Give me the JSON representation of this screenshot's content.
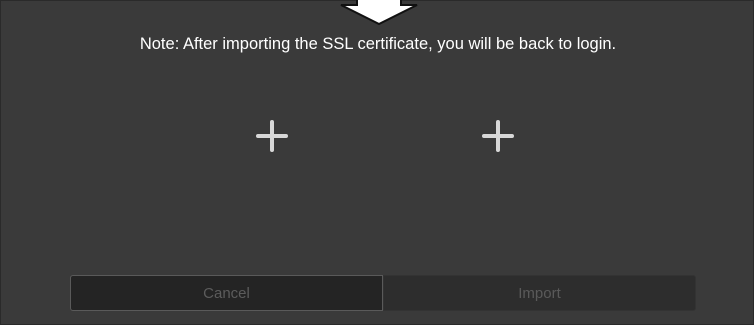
{
  "dialog": {
    "note": "Note: After importing the SSL certificate, you will be back to login.",
    "slots": [
      {
        "icon": "plus-icon"
      },
      {
        "icon": "plus-icon"
      }
    ],
    "buttons": {
      "cancel_label": "Cancel",
      "import_label": "Import"
    }
  },
  "colors": {
    "dialog_background": "#3a3a3a",
    "text": "#ffffff",
    "disabled_text": "#5a5a5a"
  }
}
